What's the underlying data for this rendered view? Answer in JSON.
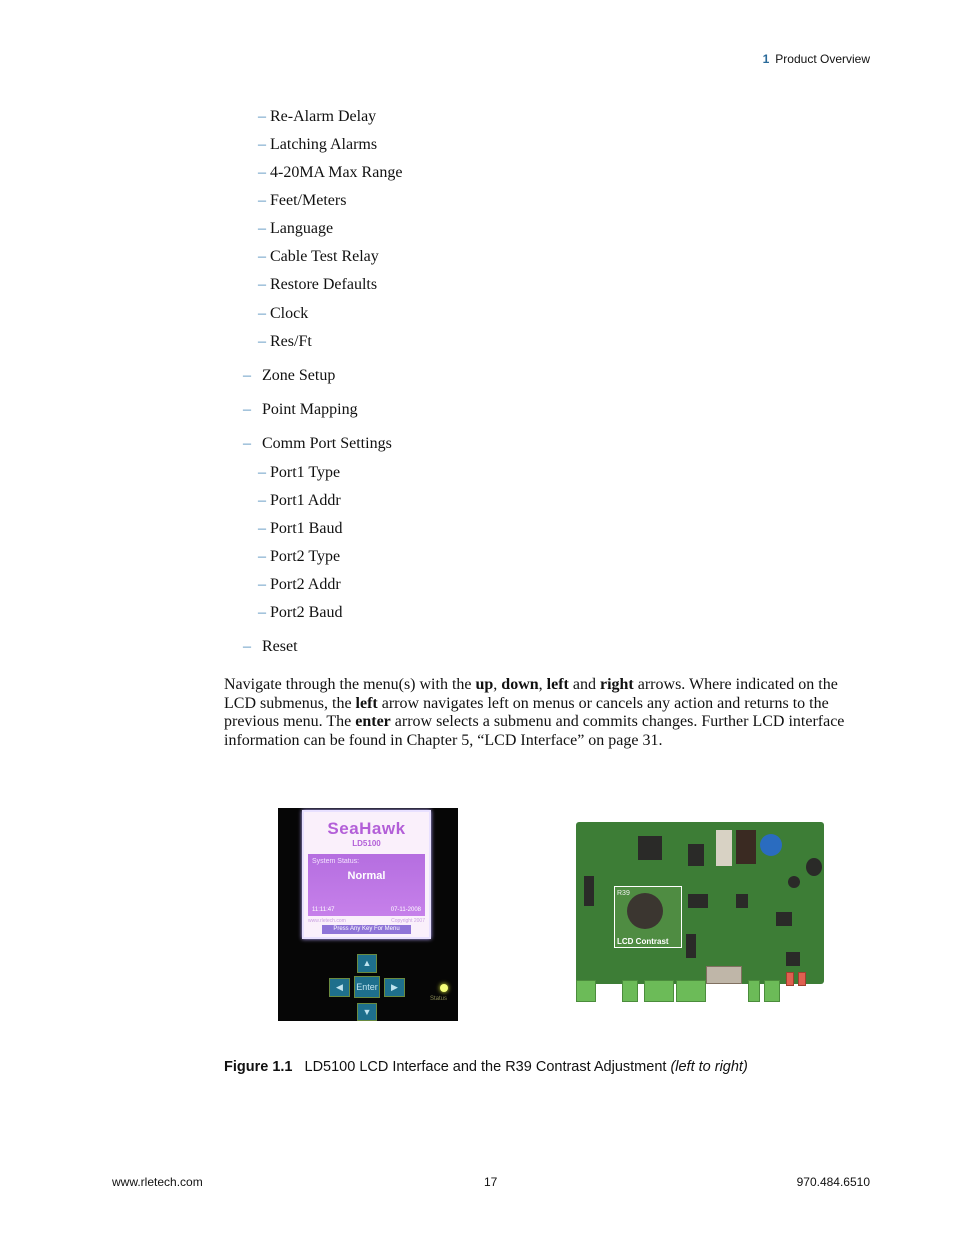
{
  "header": {
    "chapter_number": "1",
    "chapter_title": "Product Overview"
  },
  "menu": {
    "system_setup_subitems": [
      "Re-Alarm Delay",
      "Latching Alarms",
      "4-20MA Max Range",
      "Feet/Meters",
      "Language",
      "Cable Test Relay",
      "Restore Defaults",
      "Clock",
      "Res/Ft"
    ],
    "zone_setup": "Zone Setup",
    "point_mapping": "Point Mapping",
    "comm_port_settings": "Comm Port Settings",
    "comm_port_subitems": [
      "Port1 Type",
      "Port1 Addr",
      "Port1 Baud",
      "Port2 Type",
      "Port2 Addr",
      "Port2 Baud"
    ],
    "reset": "Reset",
    "dash": "–"
  },
  "paragraph": {
    "t1": "Navigate through the menu(s) with the ",
    "b1": "up",
    "t2": ", ",
    "b2": "down",
    "t3": ", ",
    "b3": "left",
    "t4": " and ",
    "b4": "right",
    "t5": " arrows. Where indicated on the LCD submenus, the ",
    "b5": "left",
    "t6": " arrow navigates left on menus or cancels any action and returns to the previous menu. The ",
    "b6": "enter",
    "t7": " arrow selects a submenu and commits changes. Further LCD interface information can be found in Chapter 5, “LCD Interface” on page 31."
  },
  "figure_left": {
    "brand": "SeaHawk",
    "model": "LD5100",
    "status_label": "System Status:",
    "status_value": "Normal",
    "time": "11:11:47",
    "date": "07-11-2008",
    "url": "www.rletech.com",
    "copyright": "Copyright 2007",
    "prompt": "Press Any Key For Menu",
    "keys": {
      "up": "▲",
      "down": "▼",
      "left": "◀",
      "right": "▶",
      "enter": "Enter"
    },
    "led_label": "Status"
  },
  "figure_right": {
    "component_label": "R39",
    "inset_label": "LCD Contrast"
  },
  "caption": {
    "figure_number": "Figure 1.1",
    "text": "LD5100 LCD Interface and the R39 Contrast Adjustment ",
    "parenthetical": "(left to right)"
  },
  "footer": {
    "website": "www.rletech.com",
    "page_number": "17",
    "phone": "970.484.6510"
  }
}
